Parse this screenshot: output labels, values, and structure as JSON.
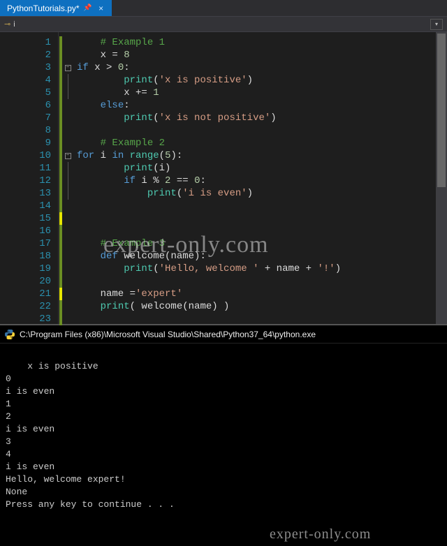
{
  "tab": {
    "filename": "PythonTutorials.py*"
  },
  "nav": {
    "scope": "i"
  },
  "code": {
    "lines": [
      {
        "n": 1,
        "mark": "g",
        "fold": "",
        "segs": [
          [
            "    ",
            ""
          ],
          [
            "# Example 1",
            "c-comment"
          ]
        ]
      },
      {
        "n": 2,
        "mark": "g",
        "fold": "",
        "segs": [
          [
            "    x = ",
            ""
          ],
          [
            "8",
            "c-num"
          ]
        ]
      },
      {
        "n": 3,
        "mark": "g",
        "fold": "box",
        "segs": [
          [
            "if",
            "c-kw"
          ],
          [
            " x > ",
            ""
          ],
          [
            "0",
            "c-num"
          ],
          [
            ":",
            ""
          ]
        ]
      },
      {
        "n": 4,
        "mark": "g",
        "fold": "line",
        "segs": [
          [
            "        ",
            ""
          ],
          [
            "print",
            "c-builtin"
          ],
          [
            "(",
            ""
          ],
          [
            "'x is positive'",
            "c-str"
          ],
          [
            ")",
            ""
          ]
        ]
      },
      {
        "n": 5,
        "mark": "g",
        "fold": "line",
        "segs": [
          [
            "        x += ",
            ""
          ],
          [
            "1",
            "c-num"
          ]
        ]
      },
      {
        "n": 6,
        "mark": "g",
        "fold": "",
        "segs": [
          [
            "    ",
            ""
          ],
          [
            "else",
            "c-kw"
          ],
          [
            ":",
            ""
          ]
        ]
      },
      {
        "n": 7,
        "mark": "g",
        "fold": "",
        "segs": [
          [
            "        ",
            ""
          ],
          [
            "print",
            "c-builtin"
          ],
          [
            "(",
            ""
          ],
          [
            "'x is not positive'",
            "c-str"
          ],
          [
            ")",
            ""
          ]
        ]
      },
      {
        "n": 8,
        "mark": "g",
        "fold": "",
        "segs": [
          [
            "",
            ""
          ]
        ]
      },
      {
        "n": 9,
        "mark": "g",
        "fold": "",
        "segs": [
          [
            "    ",
            ""
          ],
          [
            "# Example 2",
            "c-comment"
          ]
        ]
      },
      {
        "n": 10,
        "mark": "g",
        "fold": "box",
        "segs": [
          [
            "for",
            "c-kw"
          ],
          [
            " i ",
            ""
          ],
          [
            "in",
            "c-kw"
          ],
          [
            " ",
            ""
          ],
          [
            "range",
            "c-builtin"
          ],
          [
            "(",
            ""
          ],
          [
            "5",
            "c-num"
          ],
          [
            "):",
            ""
          ]
        ]
      },
      {
        "n": 11,
        "mark": "g",
        "fold": "line",
        "segs": [
          [
            "        ",
            ""
          ],
          [
            "print",
            "c-builtin"
          ],
          [
            "(i)",
            ""
          ]
        ]
      },
      {
        "n": 12,
        "mark": "g",
        "fold": "line",
        "segs": [
          [
            "        ",
            ""
          ],
          [
            "if",
            "c-kw"
          ],
          [
            " i % ",
            ""
          ],
          [
            "2",
            "c-num"
          ],
          [
            " == ",
            ""
          ],
          [
            "0",
            "c-num"
          ],
          [
            ":",
            ""
          ]
        ]
      },
      {
        "n": 13,
        "mark": "g",
        "fold": "line",
        "segs": [
          [
            "            ",
            ""
          ],
          [
            "print",
            "c-builtin"
          ],
          [
            "(",
            ""
          ],
          [
            "'i is even'",
            "c-str"
          ],
          [
            ")",
            ""
          ]
        ]
      },
      {
        "n": 14,
        "mark": "g",
        "fold": "",
        "segs": [
          [
            "",
            ""
          ]
        ]
      },
      {
        "n": 15,
        "mark": "y",
        "fold": "",
        "segs": [
          [
            "",
            ""
          ]
        ]
      },
      {
        "n": 16,
        "mark": "g",
        "fold": "",
        "segs": [
          [
            "",
            ""
          ]
        ]
      },
      {
        "n": 17,
        "mark": "g",
        "fold": "",
        "segs": [
          [
            "    ",
            ""
          ],
          [
            "# Example 3",
            "c-comment"
          ]
        ]
      },
      {
        "n": 18,
        "mark": "g",
        "fold": "",
        "segs": [
          [
            "    ",
            ""
          ],
          [
            "def",
            "c-def"
          ],
          [
            " ",
            ""
          ],
          [
            "welcome",
            "c-fn"
          ],
          [
            "(name):",
            ""
          ]
        ]
      },
      {
        "n": 19,
        "mark": "g",
        "fold": "",
        "segs": [
          [
            "        ",
            ""
          ],
          [
            "print",
            "c-builtin"
          ],
          [
            "(",
            ""
          ],
          [
            "'Hello, welcome '",
            "c-str"
          ],
          [
            " + name + ",
            ""
          ],
          [
            "'!'",
            "c-str"
          ],
          [
            ")",
            ""
          ]
        ]
      },
      {
        "n": 20,
        "mark": "g",
        "fold": "",
        "segs": [
          [
            "",
            ""
          ]
        ]
      },
      {
        "n": 21,
        "mark": "y",
        "fold": "",
        "segs": [
          [
            "    name =",
            ""
          ],
          [
            "'expert'",
            "c-str"
          ]
        ]
      },
      {
        "n": 22,
        "mark": "g",
        "fold": "",
        "segs": [
          [
            "    ",
            ""
          ],
          [
            "print",
            "c-builtin"
          ],
          [
            "( welcome(name) )",
            ""
          ]
        ]
      },
      {
        "n": 23,
        "mark": "g",
        "fold": "",
        "segs": [
          [
            "",
            ""
          ]
        ]
      }
    ]
  },
  "terminal": {
    "title": "C:\\Program Files (x86)\\Microsoft Visual Studio\\Shared\\Python37_64\\python.exe",
    "output": "x is positive\n0\ni is even\n1\n2\ni is even\n3\n4\ni is even\nHello, welcome expert!\nNone\nPress any key to continue . . ."
  },
  "watermark": "expert-only.com"
}
